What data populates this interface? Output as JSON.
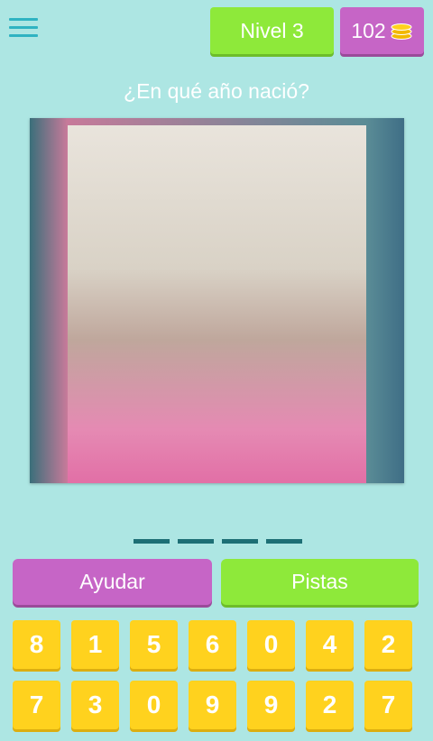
{
  "header": {
    "menu_icon": "hamburger-menu-icon",
    "level_label": "Nivel 3",
    "coins": "102",
    "coin_icon": "coin-stack-icon"
  },
  "question": "¿En qué año nació?",
  "answer_slots": 4,
  "buttons": {
    "help": "Ayudar",
    "hints": "Pistas"
  },
  "keys": [
    "8",
    "1",
    "5",
    "6",
    "0",
    "4",
    "2",
    "7",
    "3",
    "0",
    "9",
    "9",
    "2",
    "7"
  ],
  "colors": {
    "background": "#ade6e3",
    "green": "#8ee93a",
    "purple": "#c665c6",
    "key_yellow": "#ffd21e",
    "slot_dash": "#1d6f75"
  }
}
